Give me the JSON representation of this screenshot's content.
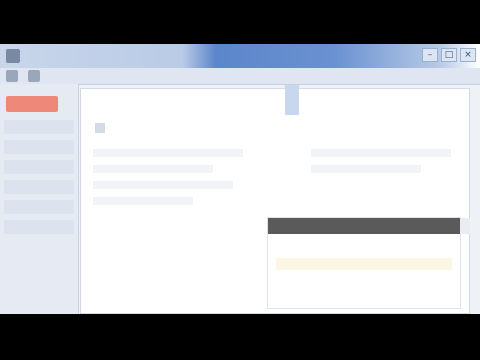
{
  "window": {
    "title": "",
    "controls": {
      "minimize": "–",
      "maximize": "□",
      "close": "×"
    }
  },
  "toolbar": {
    "items": [
      {
        "label": "",
        "icon": "app-menu-icon"
      },
      {
        "label": "",
        "icon": "toolbar-icon"
      }
    ]
  },
  "sidebar": {
    "active_tile_color": "#ee8878",
    "items": [
      {
        "label": ""
      },
      {
        "label": ""
      },
      {
        "label": ""
      },
      {
        "label": ""
      },
      {
        "label": ""
      },
      {
        "label": ""
      }
    ]
  },
  "document": {
    "header": ""
  },
  "pane": {
    "header": "",
    "rows": [
      {
        "label": ""
      },
      {
        "label": ""
      },
      {
        "label": ""
      },
      {
        "label": ""
      }
    ]
  },
  "colors": {
    "titlebar_accent": "#5b86c9",
    "pane_header": "#5a5a5a",
    "highlight_row": "#fbf7e4"
  }
}
